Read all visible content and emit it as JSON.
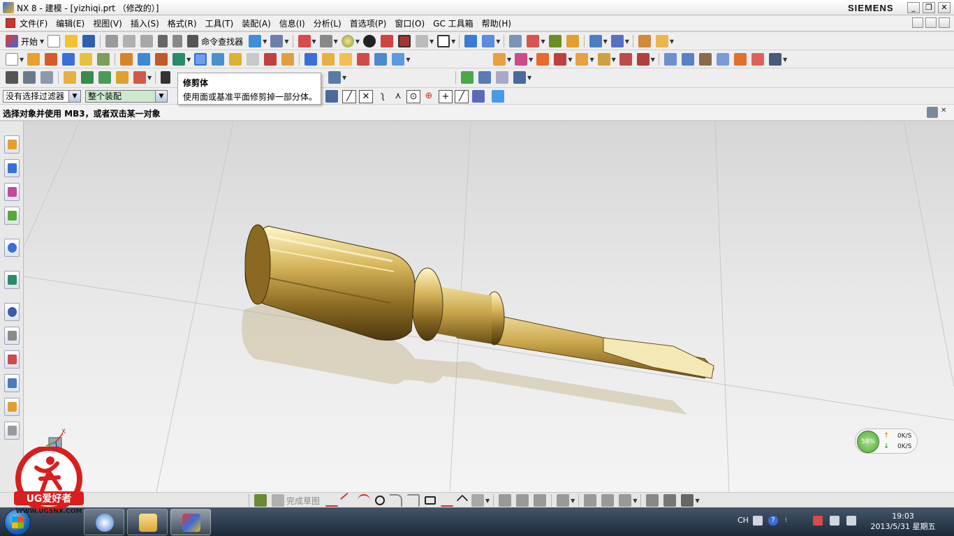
{
  "window": {
    "title": "NX 8 - 建模 - [yizhiqi.prt （修改的）]",
    "brand": "SIEMENS",
    "controls": {
      "minimize": "_",
      "maximize": "❐",
      "close": "✕"
    }
  },
  "menubar": {
    "items": [
      "文件(F)",
      "编辑(E)",
      "视图(V)",
      "插入(S)",
      "格式(R)",
      "工具(T)",
      "装配(A)",
      "信息(I)",
      "分析(L)",
      "首选项(P)",
      "窗口(O)",
      "GC 工具箱",
      "帮助(H)"
    ]
  },
  "toolbar_standard": {
    "start_label": "开始",
    "command_finder_label": "命令查找器"
  },
  "tooltip": {
    "title": "修剪体",
    "description": "使用面或基准平面修剪掉一部分体。"
  },
  "selection_bar": {
    "filter_value": "没有选择过滤器",
    "scope_value": "整个装配"
  },
  "cue_line": {
    "text": "选择对象并使用 MB3，或者双击某一对象"
  },
  "graphics": {
    "model": "screwdriver",
    "model_color": "#c9a54a",
    "background_color": "#e6e6e6",
    "triad_labels": {
      "x": "X",
      "y": "Y",
      "z": "Z"
    }
  },
  "sketch_toolbar": {
    "finish_sketch_label": "完成草图"
  },
  "network_widget": {
    "percent": "58%",
    "upload": "0K/S",
    "download": "0K/S",
    "up_arrow": "↑",
    "down_arrow": "↓"
  },
  "taskbar": {
    "ime": "CH",
    "time": "19:03",
    "date": "2013/5/31 星期五",
    "help_glyph": "?"
  },
  "watermark": {
    "brand": "UG爱好者",
    "url": "WWW.UGSNX.COM"
  }
}
